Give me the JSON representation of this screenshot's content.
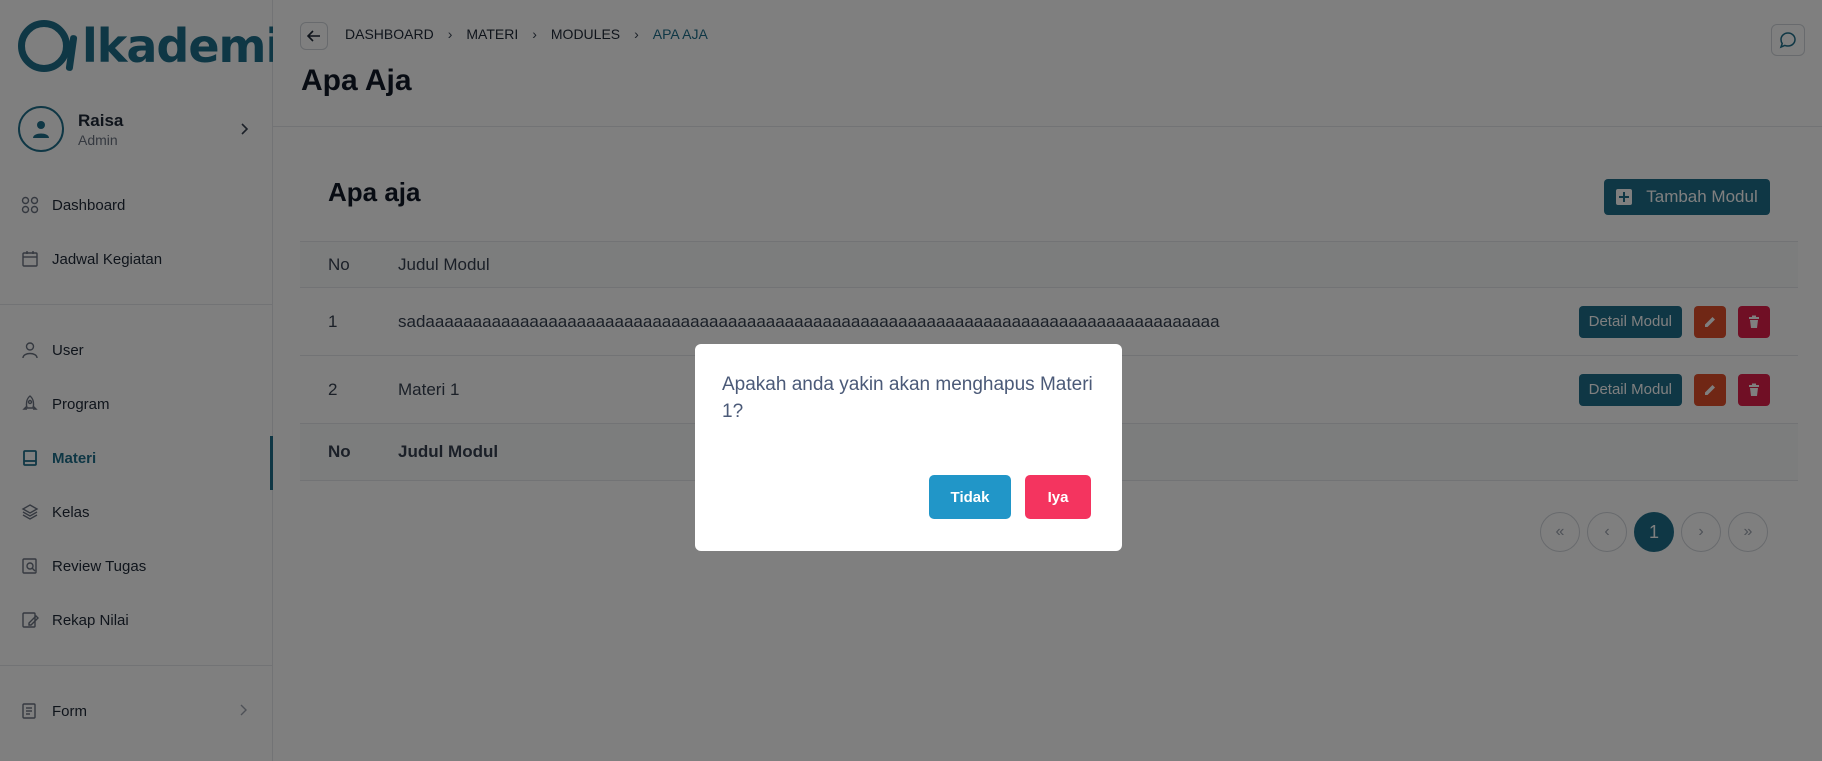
{
  "brand": {
    "logo_text": "lkademi",
    "accent": "#1f6f8b"
  },
  "user": {
    "name": "Raisa",
    "role": "Admin"
  },
  "sidebar": {
    "items": [
      {
        "label": "Dashboard",
        "icon": "grid-icon"
      },
      {
        "label": "Jadwal Kegiatan",
        "icon": "calendar-icon"
      },
      {
        "label": "User",
        "icon": "user-icon"
      },
      {
        "label": "Program",
        "icon": "rocket-icon"
      },
      {
        "label": "Materi",
        "icon": "book-icon",
        "active": true
      },
      {
        "label": "Kelas",
        "icon": "layers-icon"
      },
      {
        "label": "Review Tugas",
        "icon": "review-icon"
      },
      {
        "label": "Rekap Nilai",
        "icon": "edit-icon"
      },
      {
        "label": "Form",
        "icon": "form-icon"
      }
    ]
  },
  "header": {
    "breadcrumb": [
      "DASHBOARD",
      "MATERI",
      "MODULES",
      "APA AJA"
    ],
    "title": "Apa Aja"
  },
  "card": {
    "title": "Apa aja",
    "add_label": "Tambah Modul",
    "columns": [
      "No",
      "Judul Modul"
    ],
    "rows": [
      {
        "no": "1",
        "title": "sadaaaaaaaaaaaaaaaaaaaaaaaaaaaaaaaaaaaaaaaaaaaaaaaaaaaaaaaaaaaaaaaaaaaaaaaaaaaaaaaaaaaa"
      },
      {
        "no": "2",
        "title": "Materi 1"
      }
    ],
    "detail_label": "Detail Modul",
    "footer_columns": [
      "No",
      "Judul Modul"
    ]
  },
  "pagination": {
    "first": "«",
    "prev": "‹",
    "current": "1",
    "next": "›",
    "last": "»"
  },
  "modal": {
    "message": "Apakah anda yakin akan menghapus Materi 1?",
    "no_label": "Tidak",
    "yes_label": "Iya"
  }
}
